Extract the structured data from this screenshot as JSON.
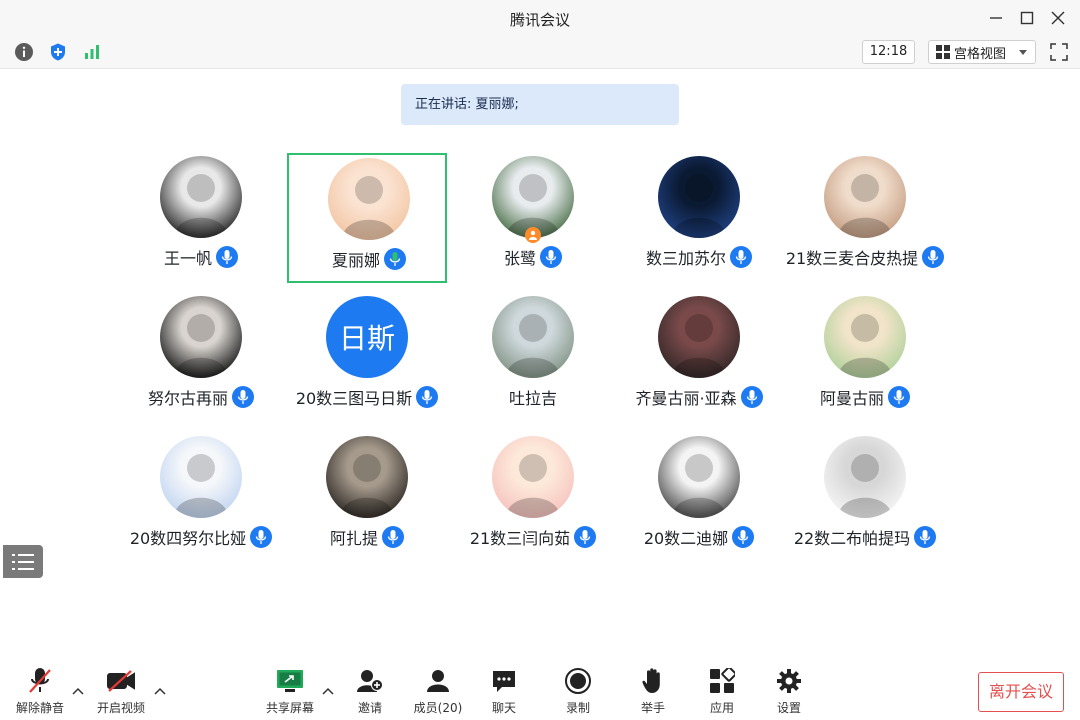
{
  "window": {
    "title": "腾讯会议"
  },
  "toolbar": {
    "time": "12:18",
    "view_mode": "宫格视图"
  },
  "speaking": {
    "text": "正在讲话: 夏丽娜;"
  },
  "participants": [
    {
      "name": "王一帆",
      "avatar": "photo",
      "mic": "on"
    },
    {
      "name": "夏丽娜",
      "avatar": "photo",
      "mic": "speaking",
      "active": true
    },
    {
      "name": "张鹭",
      "avatar": "photo",
      "mic": "on",
      "host": true
    },
    {
      "name": "数三加苏尔",
      "avatar": "photo",
      "mic": "on"
    },
    {
      "name": "21数三麦合皮热提",
      "avatar": "photo",
      "mic": "on"
    },
    {
      "name": "努尔古再丽",
      "avatar": "photo",
      "mic": "on"
    },
    {
      "name": "20数三图马日斯",
      "avatar": "text",
      "avatar_text": "日斯",
      "mic": "on"
    },
    {
      "name": "吐拉吉",
      "avatar": "photo",
      "mic": "none"
    },
    {
      "name": "齐曼古丽·亚森",
      "avatar": "photo",
      "mic": "on"
    },
    {
      "name": "阿曼古丽",
      "avatar": "photo",
      "mic": "on"
    },
    {
      "name": "20数四努尔比娅",
      "avatar": "photo",
      "mic": "on"
    },
    {
      "name": "阿扎提",
      "avatar": "photo",
      "mic": "on"
    },
    {
      "name": "21数三闫向茹",
      "avatar": "photo",
      "mic": "on"
    },
    {
      "name": "20数二迪娜",
      "avatar": "photo",
      "mic": "on"
    },
    {
      "name": "22数二布帕提玛",
      "avatar": "photo",
      "mic": "on"
    }
  ],
  "bottom": {
    "unmute": "解除静音",
    "video": "开启视频",
    "share": "共享屏幕",
    "invite": "邀请",
    "members": "成员(20)",
    "chat": "聊天",
    "record": "录制",
    "raise_hand": "举手",
    "apps": "应用",
    "settings": "设置",
    "leave": "离开会议"
  },
  "colors": {
    "accent": "#1e7af0",
    "active_border": "#2fbf71",
    "leave": "#e25050",
    "banner": "#dce9fb"
  }
}
